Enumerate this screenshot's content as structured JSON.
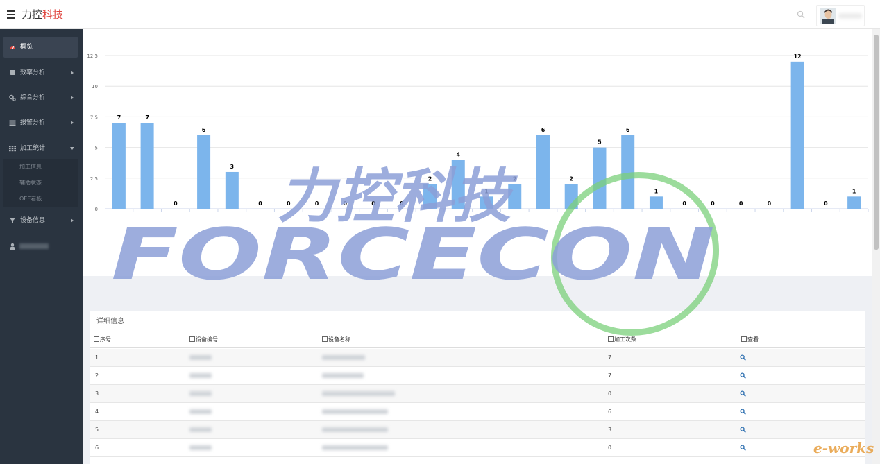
{
  "header": {
    "brand_part1": "力控",
    "brand_part2": "科技"
  },
  "sidebar": {
    "items": [
      {
        "label": "概览",
        "icon": "dashboard-icon"
      },
      {
        "label": "效率分析",
        "icon": "book-icon"
      },
      {
        "label": "综合分析",
        "icon": "gears-icon"
      },
      {
        "label": "报警分析",
        "icon": "list-icon"
      },
      {
        "label": "加工统计",
        "icon": "grid-icon"
      },
      {
        "label": "设备信息",
        "icon": "filter-icon"
      }
    ],
    "submenu": [
      "加工信息",
      "辅助状态",
      "OEE看板"
    ]
  },
  "chart_data": {
    "type": "bar",
    "yticks": [
      "0",
      "2.5",
      "5",
      "7.5",
      "10",
      "12.5"
    ],
    "ylim": [
      0,
      12.5
    ],
    "grid": true,
    "bar_color": "#7cb5ec",
    "values": [
      7,
      7,
      0,
      6,
      3,
      0,
      0,
      0,
      0,
      0,
      0,
      2,
      4,
      1,
      2,
      6,
      2,
      5,
      6,
      1,
      0,
      0,
      0,
      0,
      12,
      0,
      1
    ]
  },
  "table": {
    "title": "详细信息",
    "headers": [
      "序号",
      "设备编号",
      "设备名称",
      "加工次数",
      "查看"
    ],
    "rows": [
      {
        "index": "1",
        "count": "7"
      },
      {
        "index": "2",
        "count": "7"
      },
      {
        "index": "3",
        "count": "0"
      },
      {
        "index": "4",
        "count": "6"
      },
      {
        "index": "5",
        "count": "3"
      },
      {
        "index": "6",
        "count": "0"
      }
    ]
  },
  "watermark": {
    "cn": "力控科技",
    "en": "FORCECON",
    "corner": "e-works"
  },
  "colors": {
    "sidebar_bg": "#2a3440",
    "bar": "#7cb5ec",
    "accent_red": "#e0463f",
    "watermark_blue": "#8c9fd8",
    "watermark_green": "#7bd07b"
  }
}
